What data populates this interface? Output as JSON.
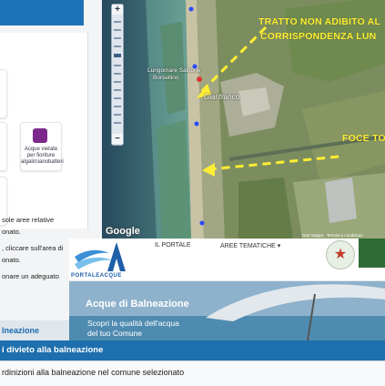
{
  "left_panel": {
    "legend_item_label": "Acque vietate per fioriture algali/cianobatteri",
    "legend_item_color": "#7b2a8c",
    "text_lines": [
      "sole aree relative",
      "onato.",
      ", cliccare sull'area di",
      "onare un adeguato"
    ]
  },
  "map": {
    "zoom_in": "+",
    "zoom_out": "−",
    "annotation_1_line_1": "TRATTO NON ADIBITO AL",
    "annotation_1_line_2": "CORRISPONDENZA LUN",
    "annotation_2": "FOCE TO",
    "place_1_line_1": "Lungomare Salcone",
    "place_1_line_2": "Borsellino",
    "place_2": "Gianfranco",
    "google_logo": "Google",
    "terms_text": "Dati mappa · Termini e condizioni",
    "accent_color": "#ffee33"
  },
  "portal": {
    "logo_caption": "PORTALEACQUE",
    "nav": [
      "IL PORTALE",
      "AREE TEMATICHE ▾"
    ],
    "hero_title": "Acque di Balneazione",
    "hero_subtitle": "Scopri la qualità dell'acqua del tuo Comune"
  },
  "sidebar": {
    "section_label": "lneazione"
  },
  "divieto": {
    "title": "i divieto alla balneazione",
    "description": "rdinizioni alla balneazione nel comune selezionato"
  }
}
